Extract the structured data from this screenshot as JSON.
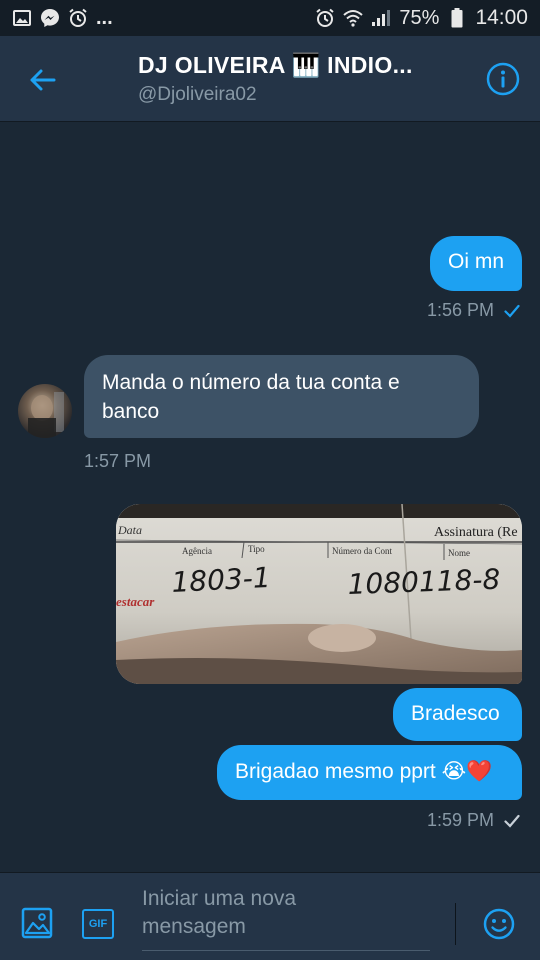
{
  "status_bar": {
    "battery": "75%",
    "time": "14:00",
    "more": "..."
  },
  "header": {
    "title": "DJ OLIVEIRA 🎹 INDIO...",
    "handle": "@Djoliveira02"
  },
  "messages": [
    {
      "direction": "out",
      "text": "Oi mn",
      "time": "1:56 PM"
    },
    {
      "direction": "in",
      "text_line1": "Manda o número da tua conta e",
      "text_line2": "banco",
      "time": "1:57 PM"
    },
    {
      "direction": "out",
      "type": "image"
    },
    {
      "direction": "out",
      "text": "Bradesco"
    },
    {
      "direction": "out",
      "text": "Brigadao mesmo pprt 😭❤️",
      "time": "1:59 PM"
    }
  ],
  "photo_text": {
    "data": "Data",
    "agencia": "Agência",
    "tipo": "Tipo",
    "numero": "Número da Cont",
    "nome": "Nome",
    "assinatura": "Assinatura (Re",
    "agency_number": "1803-1",
    "account_number": "1080118-8",
    "destacar": "estacar"
  },
  "composer": {
    "placeholder_line1": "Iniciar uma nova",
    "placeholder_line2": "mensagem",
    "gif_label": "GIF"
  },
  "colors": {
    "accent": "#1da1f2",
    "background": "#1b2835",
    "header": "#243447",
    "incoming_bubble": "#3d5266",
    "muted": "#8899a6"
  }
}
